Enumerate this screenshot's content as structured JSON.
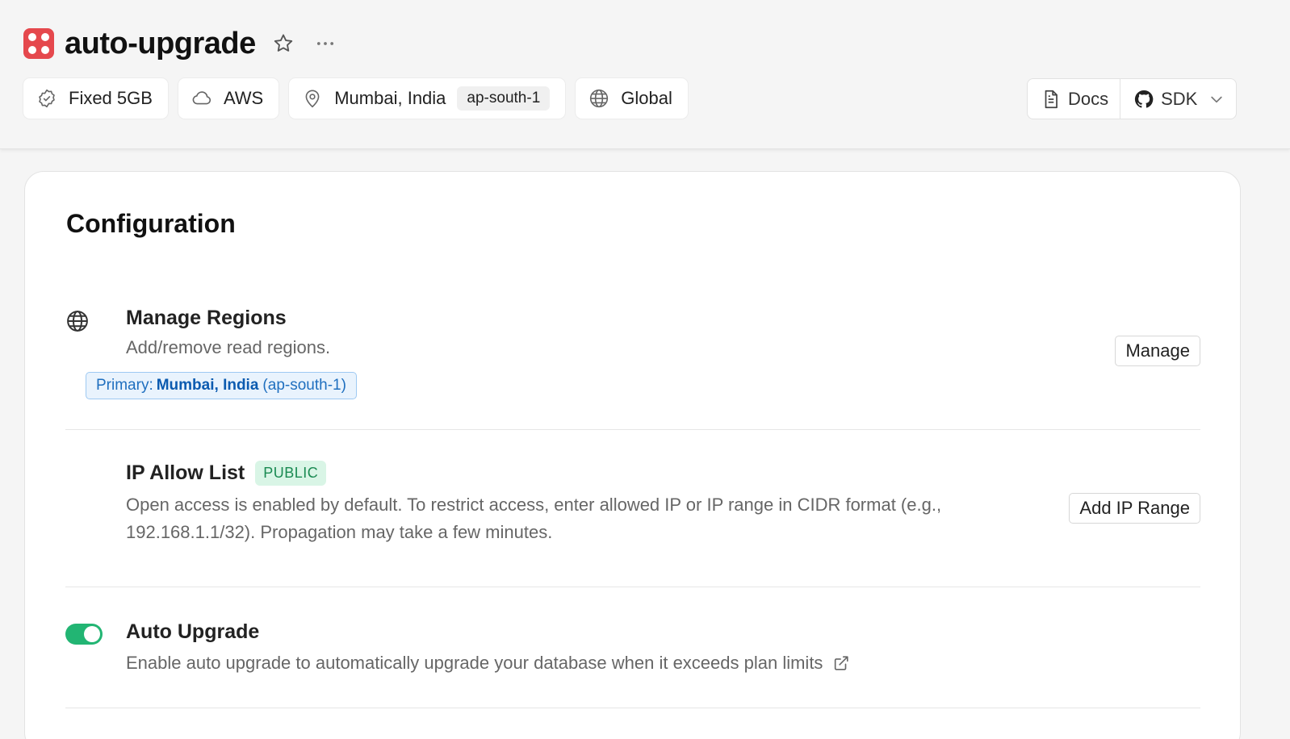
{
  "header": {
    "title": "auto-upgrade",
    "chips": [
      {
        "label": "Fixed 5GB",
        "icon": "badge-check-icon"
      },
      {
        "label": "AWS",
        "icon": "cloud-icon"
      },
      {
        "label": "Mumbai, India",
        "code": "ap-south-1",
        "icon": "map-pin-icon"
      },
      {
        "label": "Global",
        "icon": "globe-icon"
      }
    ],
    "docs_label": "Docs",
    "sdk_label": "SDK"
  },
  "config": {
    "title": "Configuration",
    "regions": {
      "title": "Manage Regions",
      "desc": "Add/remove read regions.",
      "primary_prefix": "Primary:",
      "primary_region": "Mumbai, India",
      "primary_code": "(ap-south-1)",
      "button": "Manage"
    },
    "ip": {
      "title": "IP Allow List",
      "badge": "PUBLIC",
      "desc_line1": "Open access is enabled by default. To restrict access, enter allowed IP or IP range in CIDR format (e.g.,",
      "desc_line2": "192.168.1.1/32). Propagation may take a few minutes.",
      "button": "Add IP Range"
    },
    "auto_upgrade": {
      "title": "Auto Upgrade",
      "desc": "Enable auto upgrade to automatically upgrade your database when it exceeds plan limits",
      "enabled": true
    }
  },
  "colors": {
    "brand": "#e5484d",
    "toggle_on": "#22b573",
    "badge_bg": "#d9f5e6",
    "badge_text": "#1a8a52",
    "primary_tag": "#1f6fbf"
  }
}
